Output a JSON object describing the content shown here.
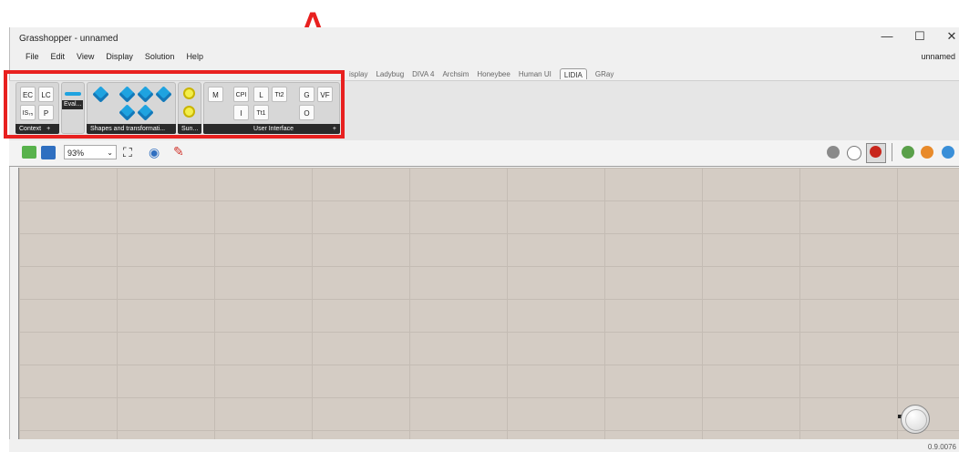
{
  "annotation": {
    "letter": "A"
  },
  "window": {
    "title": "Grasshopper - unnamed",
    "minimize": "—",
    "maximize": "☐",
    "close": "✕",
    "document_name": "unnamed"
  },
  "menu": [
    "File",
    "Edit",
    "View",
    "Display",
    "Solution",
    "Help"
  ],
  "tabs": {
    "items": [
      "isplay",
      "Ladybug",
      "DIVA 4",
      "Archsim",
      "Honeybee",
      "Human UI"
    ],
    "active": "LIDIA",
    "after": [
      "GRay"
    ]
  },
  "ribbon": {
    "context": {
      "label": "Context",
      "plus": "+",
      "buttons": [
        "EC",
        "LC",
        "IS₇₅",
        "P"
      ]
    },
    "eval": {
      "label": "Eval..."
    },
    "shapes": {
      "label": "Shapes and transformati..."
    },
    "sun": {
      "label": "Sun..."
    },
    "ui": {
      "label": "User Interface",
      "plus": "+",
      "buttons": [
        "M",
        "CPI",
        "L",
        "Tt2",
        "G",
        "VF",
        "I",
        "Tt1",
        "O"
      ]
    }
  },
  "toolbar": {
    "zoom": "93%"
  },
  "status": {
    "version": "0.9.0076"
  }
}
